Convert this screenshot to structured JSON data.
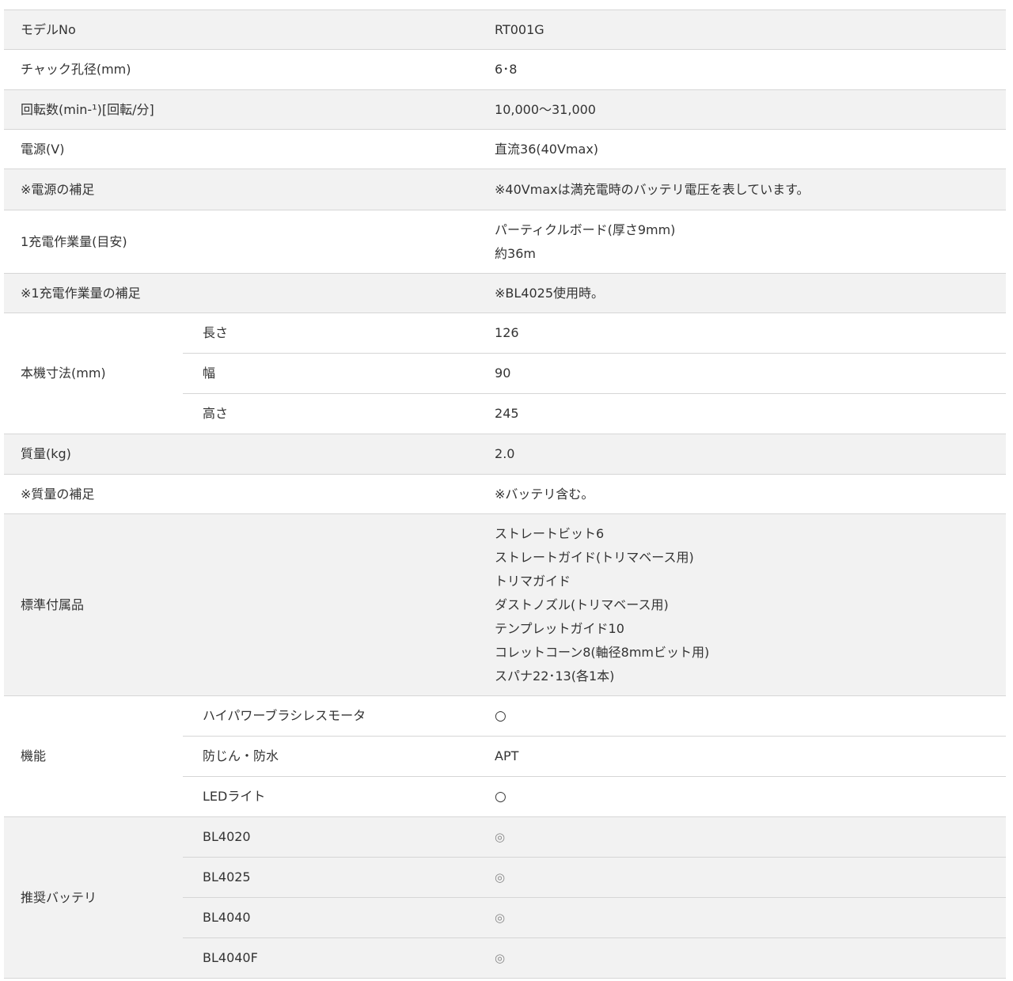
{
  "specs": [
    {
      "label": "モデルNo",
      "value": "RT001G"
    },
    {
      "label": "チャック孔径(mm)",
      "value": "6･8"
    },
    {
      "label": "回転数(min-¹)[回転/分]",
      "value": "10,000～31,000"
    },
    {
      "label": "電源(V)",
      "value": "直流36(40Vmax)"
    },
    {
      "label": "※電源の補足",
      "value": "※40Vmaxは満充電時のバッテリ電圧を表しています。"
    },
    {
      "label": "1充電作業量(目安)",
      "lines": [
        "パーティクルボード(厚さ9mm)",
        "約36m"
      ]
    },
    {
      "label": "※1充電作業量の補足",
      "value": "※BL4025使用時。"
    },
    {
      "label": "本機寸法(mm)",
      "sub": [
        {
          "label": "長さ",
          "value": "126"
        },
        {
          "label": "幅",
          "value": "90"
        },
        {
          "label": "高さ",
          "value": "245"
        }
      ]
    },
    {
      "label": "質量(kg)",
      "value": "2.0"
    },
    {
      "label": "※質量の補足",
      "value": "※バッテリ含む。"
    },
    {
      "label": "標準付属品",
      "lines": [
        "ストレートビット6",
        "ストレートガイド(トリマベース用)",
        "トリマガイド",
        "ダストノズル(トリマベース用)",
        "テンプレットガイド10",
        "コレットコーン8(軸径8mmビット用)",
        "スパナ22･13(各1本)"
      ]
    },
    {
      "label": "機能",
      "sub": [
        {
          "label": "ハイパワーブラシレスモータ",
          "value": "○"
        },
        {
          "label": "防じん・防水",
          "value": "APT"
        },
        {
          "label": "LEDライト",
          "value": "○"
        }
      ]
    },
    {
      "label": "推奨バッテリ",
      "sub": [
        {
          "label": "BL4020",
          "value": "◎"
        },
        {
          "label": "BL4025",
          "value": "◎"
        },
        {
          "label": "BL4040",
          "value": "◎"
        },
        {
          "label": "BL4040F",
          "value": "◎"
        }
      ]
    }
  ]
}
